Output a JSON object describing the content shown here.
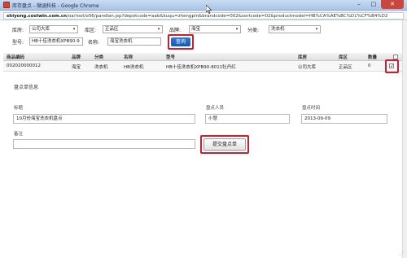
{
  "window": {
    "title": "库存盘点 - 微涵科技 - Google Chrome",
    "url_host": "shiyong.coolwin.com.cn",
    "url_path": "/oa/root/o06/pandian.jsp?depotcode=aab&kuqu=zhengpin&brandcode=002&sortcode=02&productmodel=HB%CA%AE%BC%D1%CF%B4%D2",
    "controls": {
      "minimize": "–",
      "maximize": "□",
      "close": "✕"
    }
  },
  "filters": {
    "warehouse_label": "库房:",
    "warehouse_value": "公司大库",
    "zone_label": "库区:",
    "zone_value": "正品区",
    "brand_label": "品牌:",
    "brand_value": "海宝",
    "category_label": "分类:",
    "category_value": "洗衣机",
    "model_label": "型号:",
    "model_value": "HB十佳洗衣机XPB90-9",
    "name_label": "名称:",
    "name_value": "海宝洗衣机",
    "query_label": "查询",
    "dropdown_arrow": "▾"
  },
  "table": {
    "headers": [
      "商品编码",
      "品牌",
      "分类",
      "名称",
      "型号",
      "库房",
      "库区",
      "数量"
    ],
    "rows": [
      [
        "002020000012",
        "海宝",
        "洗衣机",
        "HB洗衣机",
        "HB十佳洗衣机XPB90-8011牡丹红",
        "公司大库",
        "正品区",
        "0"
      ]
    ],
    "row_checked": true,
    "check_mark": "✓"
  },
  "form": {
    "section_title": "盘点单信息",
    "title_label": "标题",
    "title_value": "10月份海宝洗衣机盘点",
    "person_label": "盘点人员",
    "person_value": "小慧",
    "time_label": "盘点时间",
    "time_value": "2013-09-09",
    "remark_label": "备注",
    "remark_value": "",
    "submit_label": "提交盘点单"
  },
  "colors": {
    "highlight": "#c8202e",
    "query_button": "#1f66c1",
    "titlebar": "#b8d0ee"
  }
}
